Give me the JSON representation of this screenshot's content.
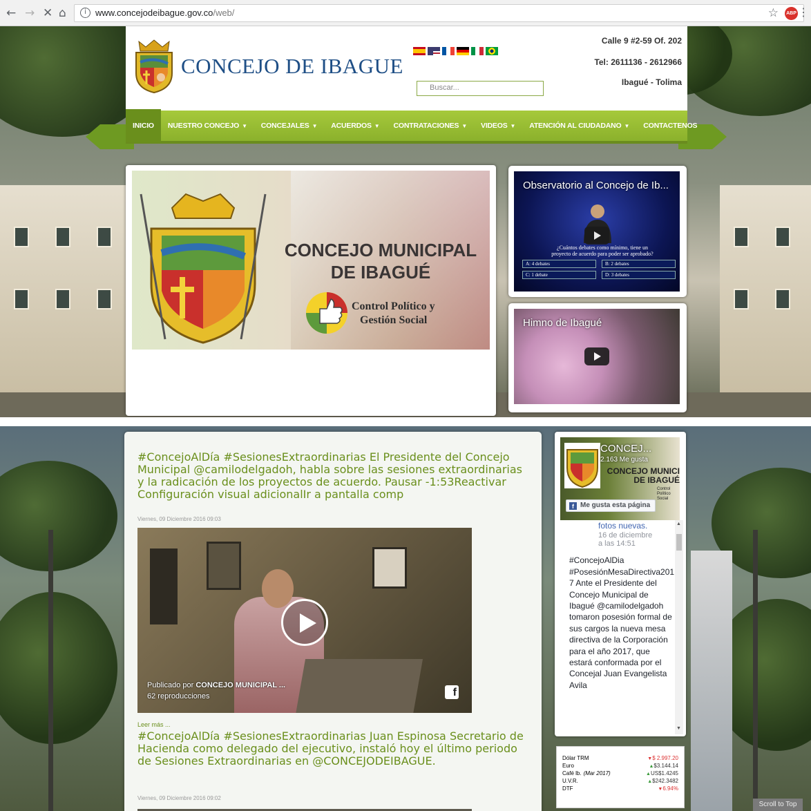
{
  "browser": {
    "url_host": "www.concejodeibague.gov.co",
    "url_path": "/web/"
  },
  "header": {
    "title": "CONCEJO DE IBAGUE",
    "search_placeholder": "Buscar...",
    "address": "Calle 9 #2-59 Of. 202",
    "phone": "Tel: 2611136 - 2612966",
    "city": "Ibagué - Tolima"
  },
  "nav": {
    "items": [
      {
        "label": "INICIO",
        "active": true,
        "dropdown": false
      },
      {
        "label": "NUESTRO CONCEJO",
        "active": false,
        "dropdown": true
      },
      {
        "label": "CONCEJALES",
        "active": false,
        "dropdown": true
      },
      {
        "label": "ACUERDOS",
        "active": false,
        "dropdown": true
      },
      {
        "label": "CONTRATACIONES",
        "active": false,
        "dropdown": true
      },
      {
        "label": "VIDEOS",
        "active": false,
        "dropdown": true
      },
      {
        "label": "ATENCIÓN AL CIUDADANO",
        "active": false,
        "dropdown": true
      },
      {
        "label": "CONTACTENOS",
        "active": false,
        "dropdown": false
      }
    ]
  },
  "slider": {
    "title_line1": "CONCEJO MUNICIPAL",
    "title_line2": "DE IBAGUÉ",
    "sub_line1": "Control Político y",
    "sub_line2": "Gestión Social"
  },
  "videos": [
    {
      "title": "Observatorio al Concejo de Ib...",
      "question_line1": "¿Cuántos debates como mínimo, tiene un",
      "question_line2": "proyecto de acuerdo para poder ser aprobado?",
      "answers": [
        "A: 4 debates",
        "B: 2 debates",
        "C: 1 debate",
        "D: 3 debates"
      ]
    },
    {
      "title": "Himno de Ibagué"
    }
  ],
  "articles": [
    {
      "headline": "#ConcejoAlDía #SesionesExtraordinarias El Presidente del Concejo Municipal @camilodelgadoh, habla sobre las sesiones extraordinarias y la radicación de los proyectos de acuerdo. Pausar -1:53Reactivar Configuración visual adicionalIr a pantalla comp",
      "date": "Viernes, 09 Diciembre 2016 09:03",
      "video_publisher_prefix": "Publicado por ",
      "video_publisher": "CONCEJO MUNICIPAL ...",
      "video_views": "62 reproducciones",
      "read_more": "Leer más ..."
    },
    {
      "headline": "#ConcejoAlDía #SesionesExtraordinarias Juan Espinosa Secretario de Hacienda como delegado del ejecutivo, instaló hoy el último periodo de Sesiones Extraordinarias en @CONCEJODEIBAGUE.",
      "date": "Viernes, 09 Diciembre 2016 09:02"
    }
  ],
  "facebook": {
    "page_name": "CONCEJ...",
    "likes": "2.163 Me gusta",
    "banner_line1": "CONCEJO MUNICI",
    "banner_line2": "DE IBAGUÉ",
    "banner_small": "Control Político",
    "banner_small2": "Social",
    "like_button": "Me gusta esta página",
    "feed_top_cut": "fotos nuevas.",
    "feed_time1": "16 de diciembre",
    "feed_time2": "a las 14:51",
    "post": "#ConcejoAlDia #PosesiónMesaDirectiva2017 Ante el Presidente del Concejo Municipal de Ibagué @camilodelgadoh tomaron posesión formal de sus cargos la nueva mesa directiva de la Corporación para el año 2017, que estará conformada por el Concejal Juan Evangelista Avila"
  },
  "finance": [
    {
      "label": "Dólar TRM",
      "label_note": "",
      "trend": "down",
      "value": "$ 2.997.20"
    },
    {
      "label": "Euro",
      "label_note": "",
      "trend": "up",
      "value": "$3.144.14"
    },
    {
      "label": "Café lb.",
      "label_note": "(Mar 2017)",
      "trend": "up",
      "value": "US$1.4245"
    },
    {
      "label": "U.V.R.",
      "label_note": "",
      "trend": "up",
      "value": "$242.3482"
    },
    {
      "label": "DTF",
      "label_note": "",
      "trend": "down",
      "value": "6.94%"
    }
  ],
  "scroll_to_top": "Scroll to Top",
  "colors": {
    "brand_green": "#8bb12c",
    "title_blue": "#1f4f86",
    "link_green": "#6a8f1c"
  }
}
